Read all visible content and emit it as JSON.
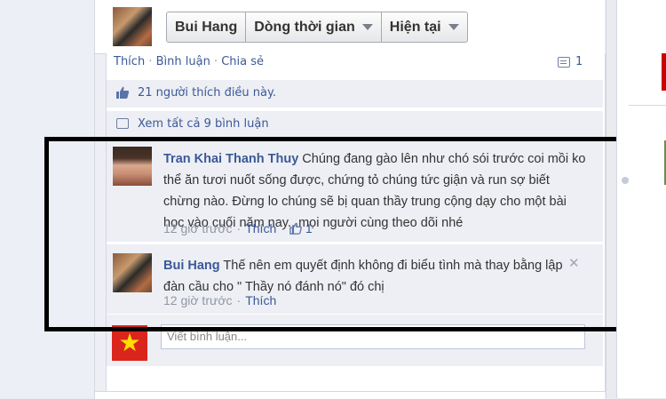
{
  "header": {
    "profile_name": "Bui Hang",
    "timeline_label": "Dòng thời gian",
    "current_label": "Hiện tại"
  },
  "post": {
    "actions": [
      "Thích",
      "Bình luận",
      "Chia sẻ"
    ],
    "separator": "·",
    "comment_count": "1",
    "likes_text": "21 người thích điều này.",
    "view_all_text": "Xem tất cả 9 bình luận"
  },
  "comments": [
    {
      "author": "Tran Khai Thanh Thuy",
      "text": "Chúng đang gào lên như chó sói trước coi mồi ko thể ăn tươi nuốt sống được, chứng tỏ chúng tức giận và run sợ biết chừng nào. Đừng lo chúng sẽ bị quan thầy trung cộng dạy cho một bài học vào cuối năm nay...mọi người cùng theo dõi nhé",
      "time": "12 giờ trước",
      "like_label": "Thích",
      "like_count": "1"
    },
    {
      "author": "Bui Hang",
      "text": "Thế nên em quyết định không đi biểu tình mà thay bằng lập đàn cầu cho \" Thầy nó đánh nó\" đó chị",
      "time": "12 giờ trước",
      "like_label": "Thích"
    }
  ],
  "write_comment": {
    "placeholder": "Viết bình luận..."
  },
  "icons": {
    "close": "close-icon",
    "like": "thumbs-up-icon",
    "comment": "comment-bubble-icon",
    "dropdown": "chevron-down-icon"
  },
  "colors": {
    "link": "#3b5998",
    "meta": "#9197a3",
    "highlight_box": "#000000",
    "flag_red": "#da251d",
    "flag_star": "#ffde00"
  }
}
